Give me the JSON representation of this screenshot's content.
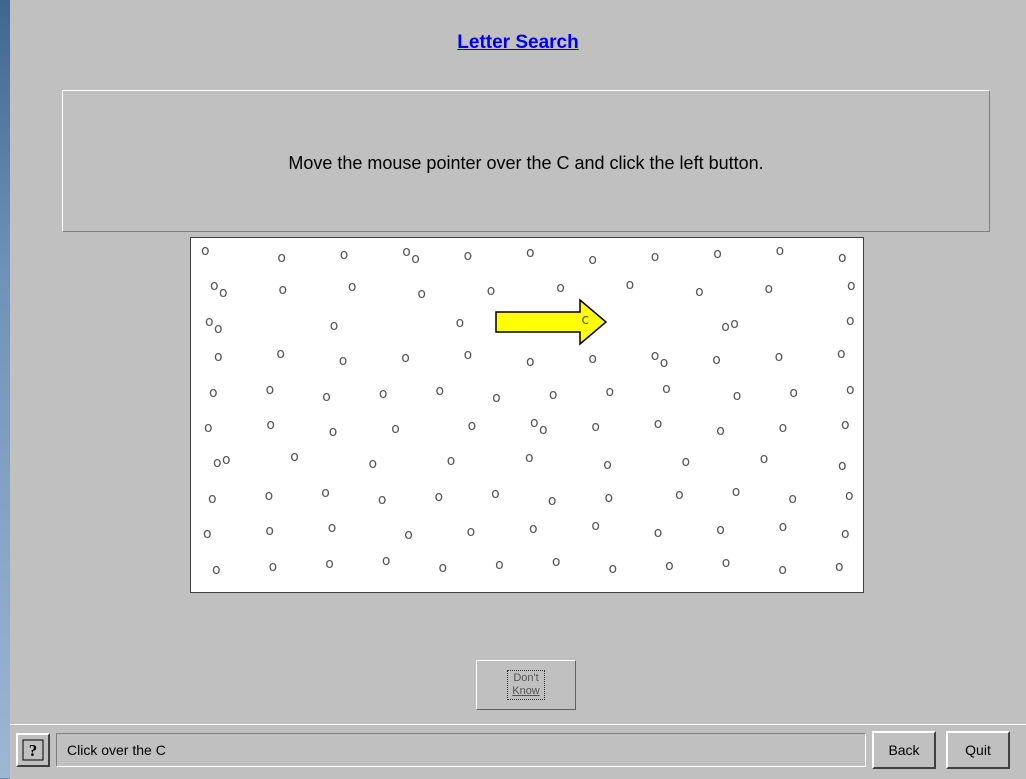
{
  "title": "Letter Search",
  "instruction": "Move the mouse pointer over the C and click the left button.",
  "search_area": {
    "target_letter": "C",
    "distractor_glyph": "o",
    "pointer_hint": "yellow-arrow-icon",
    "glyph_grid": [
      "O  O  O  OO  O O O O  O O O",
      "OO O O O O O O O O O",
      "OO O O C OO O",
      "O O O O O O O OO O O O",
      "O O O O O O O O O O O O",
      "O O O O O OO O O O O O",
      "OO O O O O O O O O",
      "O O O O O O O O O O O O",
      "O O O O O O O O O O O",
      "O O O O O O O O O O O O"
    ]
  },
  "dont_know": {
    "line1": "Don't",
    "line2": "Know"
  },
  "status": {
    "help_icon": "help-question-icon",
    "text": "Click over the C"
  },
  "nav": {
    "back": "Back",
    "quit": "Quit"
  },
  "colors": {
    "title": "#0000ee",
    "arrow_fill": "#ffff00",
    "panel": "#c0c0c0"
  }
}
